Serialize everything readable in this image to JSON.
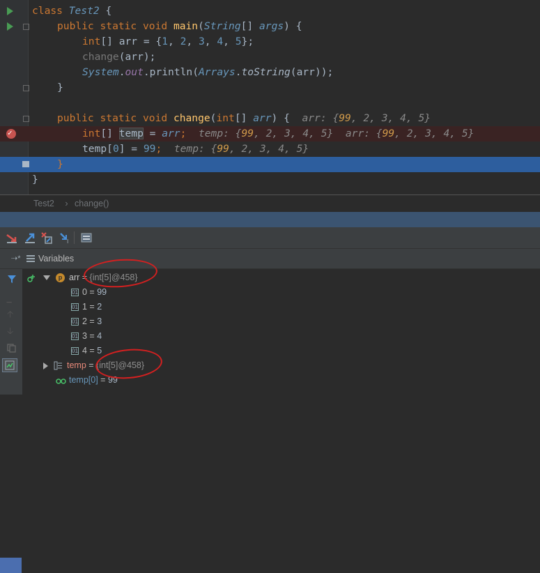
{
  "editor": {
    "lines": {
      "l1": {
        "kw": "class",
        "name": "Test2",
        "brace": "{"
      },
      "l2": {
        "kw": "public static void",
        "fn": "main",
        "p1": "(",
        "type": "String",
        "p2": "[]",
        "arg": "args",
        "p3": ")",
        "brace": "{"
      },
      "l3": {
        "kw": "int",
        "a1": "[] arr = {",
        "n1": "1",
        "c1": ", ",
        "n2": "2",
        "c2": ", ",
        "n3": "3",
        "c3": ", ",
        "n4": "4",
        "c4": ", ",
        "n5": "5",
        "end": "};"
      },
      "l4": {
        "fn": "change",
        "rest": "(arr);"
      },
      "l5": {
        "cls": "System",
        "dot1": ".",
        "field": "out",
        "dot2": ".",
        "fn": "println",
        "p1": "(",
        "cls2": "Arrays",
        "dot3": ".",
        "fn2": "toString",
        "rest": "(arr));"
      },
      "l6": {
        "brace": "}"
      },
      "l8": {
        "kw": "public static void",
        "fn": "change",
        "p1": "(",
        "kw2": "int",
        "rest": "[] ",
        "arg": "arr",
        "p2": ")",
        "brace": "{",
        "hint_label": "arr: {",
        "hint_n": "99",
        "hint_rest": ", 2, 3, 4, 5}"
      },
      "l9": {
        "kw": "int",
        "a1": "[] ",
        "var": "temp",
        "a2": " = ",
        "arg": "arr",
        "semi": ";",
        "hint1_label": "temp: {",
        "hint1_n": "99",
        "hint1_rest": ", 2, 3, 4, 5}",
        "hint2_label": "arr: {",
        "hint2_n": "99",
        "hint2_rest": ", 2, 3, 4, 5}"
      },
      "l10": {
        "a1": "temp[",
        "n0": "0",
        "a2": "] = ",
        "n99": "99",
        "semi": ";",
        "hint_label": "temp: {",
        "hint_n": "99",
        "hint_rest": ", 2, 3, 4, 5}"
      },
      "l11": {
        "brace": "}"
      },
      "l12": {
        "brace": "}"
      }
    }
  },
  "breadcrumb": {
    "file": "Test2",
    "sep": "›",
    "method": "change()"
  },
  "variables": {
    "title": "Variables",
    "rows": [
      {
        "name": "arr",
        "eq": " = ",
        "value": "{int[5]@458}"
      },
      {
        "name": "0",
        "eq": " = ",
        "value": "99"
      },
      {
        "name": "1",
        "eq": " = ",
        "value": "2"
      },
      {
        "name": "2",
        "eq": " = ",
        "value": "3"
      },
      {
        "name": "3",
        "eq": " = ",
        "value": "4"
      },
      {
        "name": "4",
        "eq": " = ",
        "value": "5"
      },
      {
        "name": "temp",
        "eq": " = ",
        "value": "{int[5]@458}"
      },
      {
        "name": "temp[0]",
        "eq": " = ",
        "value": "99"
      }
    ],
    "param_badge": "p",
    "array_badge": "01"
  },
  "colors": {
    "accent_blue": "#2d5e9e",
    "breakpoint": "#c75450",
    "annotation_red": "#d42020"
  }
}
